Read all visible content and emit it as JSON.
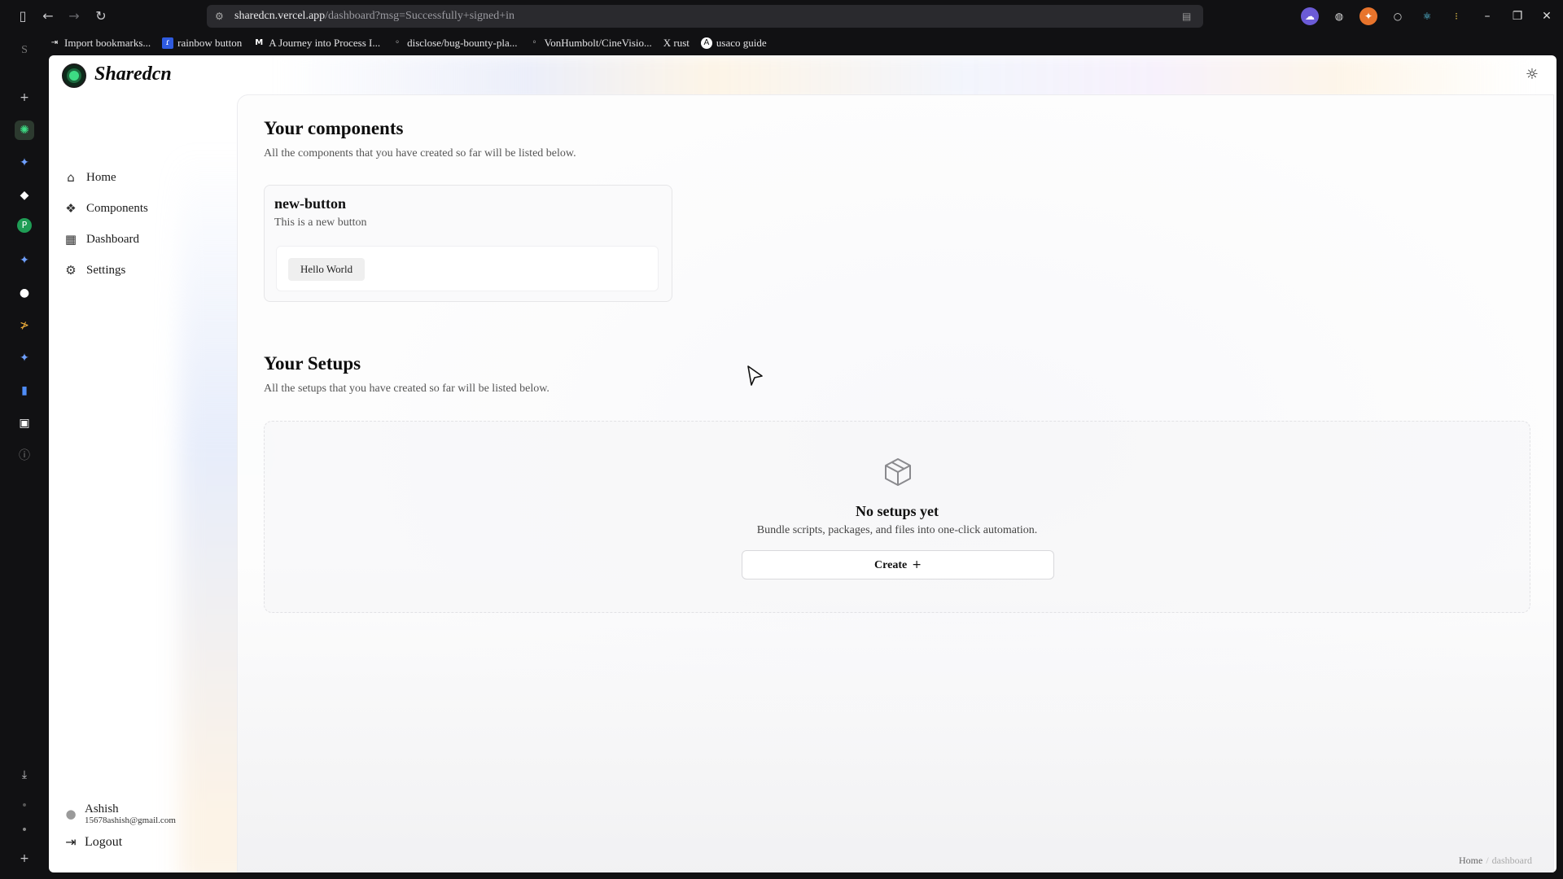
{
  "browser": {
    "url_host": "sharedcn.vercel.app",
    "url_path": "/dashboard?msg=Successfully+signed+in",
    "rail_letter": "S",
    "bookmarks": [
      {
        "label": "Import bookmarks...",
        "icon": "import-icon"
      },
      {
        "label": "rainbow button",
        "icon": "rainbow-icon"
      },
      {
        "label": "A Journey into Process I...",
        "icon": "medium-icon"
      },
      {
        "label": "disclose/bug-bounty-pla...",
        "icon": "github-icon"
      },
      {
        "label": "VonHumbolt/CineVisio...",
        "icon": "github-icon"
      },
      {
        "label": "X rust",
        "icon": "x-icon"
      },
      {
        "label": "usaco guide",
        "icon": "usaco-icon"
      }
    ]
  },
  "app": {
    "brand": "Sharedcn",
    "nav": [
      {
        "label": "Home",
        "icon": "home-icon"
      },
      {
        "label": "Components",
        "icon": "components-icon"
      },
      {
        "label": "Dashboard",
        "icon": "dashboard-icon"
      },
      {
        "label": "Settings",
        "icon": "settings-icon"
      }
    ],
    "user": {
      "name": "Ashish",
      "email": "15678ashish@gmail.com"
    },
    "logout_label": "Logout"
  },
  "components_section": {
    "title": "Your components",
    "subtitle": "All the components that you have created so far will be listed below.",
    "cards": [
      {
        "name": "new-button",
        "description": "This is a new button",
        "preview_label": "Hello World"
      }
    ]
  },
  "setups_section": {
    "title": "Your Setups",
    "subtitle": "All the setups that you have created so far will be listed below.",
    "empty_title": "No setups yet",
    "empty_subtitle": "Bundle scripts, packages, and files into one-click automation.",
    "create_label": "Create"
  },
  "breadcrumb": {
    "home": "Home",
    "current": "dashboard"
  }
}
